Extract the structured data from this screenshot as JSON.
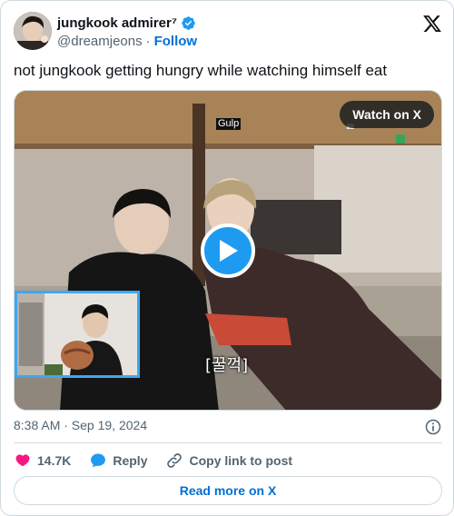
{
  "author": {
    "display_name": "jungkook admirer⁷",
    "handle": "@dreamjeons",
    "separator": "·",
    "follow_label": "Follow"
  },
  "tweet": {
    "text": "not jungkook getting hungry while watching himself eat"
  },
  "media": {
    "watch_label": "Watch on X",
    "caption_top": "Gulp",
    "subtitle": "[꿀꺽]"
  },
  "meta": {
    "timestamp": "8:38 AM · Sep 19, 2024"
  },
  "actions": {
    "likes": "14.7K",
    "reply_label": "Reply",
    "copy_label": "Copy link to post"
  },
  "footer": {
    "read_more_label": "Read more on X"
  },
  "colors": {
    "accent_blue": "#1d9bf0",
    "link_blue": "#006fd6",
    "like_red": "#f91880",
    "secondary_text": "#536471"
  },
  "icons": [
    "verified-badge-icon",
    "x-logo-icon",
    "play-icon",
    "info-icon",
    "heart-icon",
    "reply-bubble-icon",
    "link-icon"
  ]
}
